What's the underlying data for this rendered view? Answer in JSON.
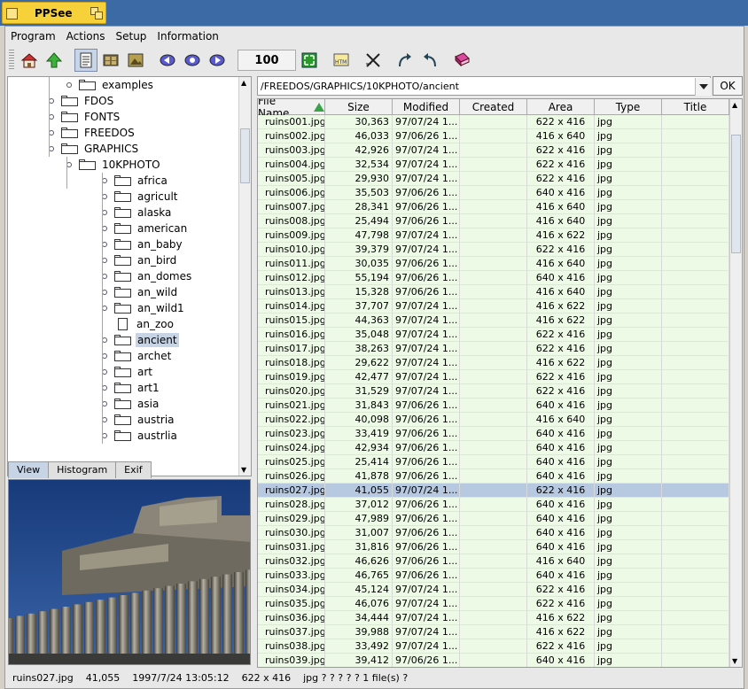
{
  "taskbar": {
    "app_title": "PPSee"
  },
  "menu": [
    "Program",
    "Actions",
    "Setup",
    "Information"
  ],
  "toolbar": {
    "zoom": "100",
    "icons": [
      "home-icon",
      "up-arrow-icon",
      "document-view-icon",
      "thumbnail-view-icon",
      "image-view-icon",
      "prev-icon",
      "play-icon",
      "next-icon",
      "fit-icon",
      "html-icon",
      "close-x-icon",
      "rotate-right-icon",
      "rotate-left-icon",
      "book-icon"
    ]
  },
  "tree": {
    "items": [
      {
        "label": "examples",
        "level": 2,
        "kind": "folder"
      },
      {
        "label": "FDOS",
        "level": 1,
        "kind": "folder"
      },
      {
        "label": "FONTS",
        "level": 1,
        "kind": "folder"
      },
      {
        "label": "FREEDOS",
        "level": 1,
        "kind": "folder"
      },
      {
        "label": "GRAPHICS",
        "level": 1,
        "kind": "folder"
      },
      {
        "label": "10KPHOTO",
        "level": 2,
        "kind": "folder"
      },
      {
        "label": "africa",
        "level": 3,
        "kind": "folder"
      },
      {
        "label": "agricult",
        "level": 3,
        "kind": "folder"
      },
      {
        "label": "alaska",
        "level": 3,
        "kind": "folder"
      },
      {
        "label": "american",
        "level": 3,
        "kind": "folder"
      },
      {
        "label": "an_baby",
        "level": 3,
        "kind": "folder"
      },
      {
        "label": "an_bird",
        "level": 3,
        "kind": "folder"
      },
      {
        "label": "an_domes",
        "level": 3,
        "kind": "folder"
      },
      {
        "label": "an_wild",
        "level": 3,
        "kind": "folder"
      },
      {
        "label": "an_wild1",
        "level": 3,
        "kind": "folder"
      },
      {
        "label": "an_zoo",
        "level": 3,
        "kind": "file"
      },
      {
        "label": "ancient",
        "level": 3,
        "kind": "folder",
        "selected": true
      },
      {
        "label": "archet",
        "level": 3,
        "kind": "folder"
      },
      {
        "label": "art",
        "level": 3,
        "kind": "folder"
      },
      {
        "label": "art1",
        "level": 3,
        "kind": "folder"
      },
      {
        "label": "asia",
        "level": 3,
        "kind": "folder"
      },
      {
        "label": "austria",
        "level": 3,
        "kind": "folder"
      },
      {
        "label": "austrlia",
        "level": 3,
        "kind": "folder"
      }
    ]
  },
  "tabs": [
    "View",
    "Histogram",
    "Exif"
  ],
  "path": "/FREEDOS/GRAPHICS/10KPHOTO/ancient",
  "ok_label": "OK",
  "columns": [
    "File Name",
    "Size",
    "Modified",
    "Created",
    "Area",
    "Type",
    "Title"
  ],
  "rows": [
    [
      "ruins001.jpg",
      "30,363",
      "97/07/24 1...",
      "",
      "622 x 416",
      "jpg",
      ""
    ],
    [
      "ruins002.jpg",
      "46,033",
      "97/06/26 1...",
      "",
      "416 x 640",
      "jpg",
      ""
    ],
    [
      "ruins003.jpg",
      "42,926",
      "97/07/24 1...",
      "",
      "622 x 416",
      "jpg",
      ""
    ],
    [
      "ruins004.jpg",
      "32,534",
      "97/07/24 1...",
      "",
      "622 x 416",
      "jpg",
      ""
    ],
    [
      "ruins005.jpg",
      "29,930",
      "97/07/24 1...",
      "",
      "622 x 416",
      "jpg",
      ""
    ],
    [
      "ruins006.jpg",
      "35,503",
      "97/06/26 1...",
      "",
      "640 x 416",
      "jpg",
      ""
    ],
    [
      "ruins007.jpg",
      "28,341",
      "97/06/26 1...",
      "",
      "416 x 640",
      "jpg",
      ""
    ],
    [
      "ruins008.jpg",
      "25,494",
      "97/06/26 1...",
      "",
      "416 x 640",
      "jpg",
      ""
    ],
    [
      "ruins009.jpg",
      "47,798",
      "97/07/24 1...",
      "",
      "416 x 622",
      "jpg",
      ""
    ],
    [
      "ruins010.jpg",
      "39,379",
      "97/07/24 1...",
      "",
      "622 x 416",
      "jpg",
      ""
    ],
    [
      "ruins011.jpg",
      "30,035",
      "97/06/26 1...",
      "",
      "416 x 640",
      "jpg",
      ""
    ],
    [
      "ruins012.jpg",
      "55,194",
      "97/06/26 1...",
      "",
      "640 x 416",
      "jpg",
      ""
    ],
    [
      "ruins013.jpg",
      "15,328",
      "97/06/26 1...",
      "",
      "416 x 640",
      "jpg",
      ""
    ],
    [
      "ruins014.jpg",
      "37,707",
      "97/07/24 1...",
      "",
      "416 x 622",
      "jpg",
      ""
    ],
    [
      "ruins015.jpg",
      "44,363",
      "97/07/24 1...",
      "",
      "416 x 622",
      "jpg",
      ""
    ],
    [
      "ruins016.jpg",
      "35,048",
      "97/07/24 1...",
      "",
      "622 x 416",
      "jpg",
      ""
    ],
    [
      "ruins017.jpg",
      "38,263",
      "97/07/24 1...",
      "",
      "622 x 416",
      "jpg",
      ""
    ],
    [
      "ruins018.jpg",
      "29,622",
      "97/07/24 1...",
      "",
      "416 x 622",
      "jpg",
      ""
    ],
    [
      "ruins019.jpg",
      "42,477",
      "97/07/24 1...",
      "",
      "622 x 416",
      "jpg",
      ""
    ],
    [
      "ruins020.jpg",
      "31,529",
      "97/07/24 1...",
      "",
      "622 x 416",
      "jpg",
      ""
    ],
    [
      "ruins021.jpg",
      "31,843",
      "97/06/26 1...",
      "",
      "640 x 416",
      "jpg",
      ""
    ],
    [
      "ruins022.jpg",
      "40,098",
      "97/06/26 1...",
      "",
      "416 x 640",
      "jpg",
      ""
    ],
    [
      "ruins023.jpg",
      "33,419",
      "97/06/26 1...",
      "",
      "640 x 416",
      "jpg",
      ""
    ],
    [
      "ruins024.jpg",
      "42,934",
      "97/06/26 1...",
      "",
      "640 x 416",
      "jpg",
      ""
    ],
    [
      "ruins025.jpg",
      "25,414",
      "97/06/26 1...",
      "",
      "640 x 416",
      "jpg",
      ""
    ],
    [
      "ruins026.jpg",
      "41,878",
      "97/06/26 1...",
      "",
      "640 x 416",
      "jpg",
      ""
    ],
    [
      "ruins027.jpg",
      "41,055",
      "97/07/24 1...",
      "",
      "622 x 416",
      "jpg",
      ""
    ],
    [
      "ruins028.jpg",
      "37,012",
      "97/06/26 1...",
      "",
      "640 x 416",
      "jpg",
      ""
    ],
    [
      "ruins029.jpg",
      "47,989",
      "97/06/26 1...",
      "",
      "640 x 416",
      "jpg",
      ""
    ],
    [
      "ruins030.jpg",
      "31,007",
      "97/06/26 1...",
      "",
      "640 x 416",
      "jpg",
      ""
    ],
    [
      "ruins031.jpg",
      "31,816",
      "97/06/26 1...",
      "",
      "640 x 416",
      "jpg",
      ""
    ],
    [
      "ruins032.jpg",
      "46,626",
      "97/06/26 1...",
      "",
      "416 x 640",
      "jpg",
      ""
    ],
    [
      "ruins033.jpg",
      "46,765",
      "97/06/26 1...",
      "",
      "640 x 416",
      "jpg",
      ""
    ],
    [
      "ruins034.jpg",
      "45,124",
      "97/07/24 1...",
      "",
      "622 x 416",
      "jpg",
      ""
    ],
    [
      "ruins035.jpg",
      "46,076",
      "97/07/24 1...",
      "",
      "622 x 416",
      "jpg",
      ""
    ],
    [
      "ruins036.jpg",
      "34,444",
      "97/07/24 1...",
      "",
      "416 x 622",
      "jpg",
      ""
    ],
    [
      "ruins037.jpg",
      "39,988",
      "97/07/24 1...",
      "",
      "416 x 622",
      "jpg",
      ""
    ],
    [
      "ruins038.jpg",
      "33,492",
      "97/07/24 1...",
      "",
      "622 x 416",
      "jpg",
      ""
    ],
    [
      "ruins039.jpg",
      "39,412",
      "97/06/26 1...",
      "",
      "640 x 416",
      "jpg",
      ""
    ]
  ],
  "selected_row": 26,
  "status": {
    "file": "ruins027.jpg",
    "size": "41,055",
    "datetime": "1997/7/24 13:05:12",
    "area": "622 x 416",
    "rest": "jpg  ?  ?  ?  ?  ?  1 file(s)  ?"
  },
  "colors": {
    "taskbar": "#3c6aa4",
    "task_tab": "#f6d13a",
    "row_bg": "#edfae6",
    "row_selected": "#b6c9e1"
  }
}
